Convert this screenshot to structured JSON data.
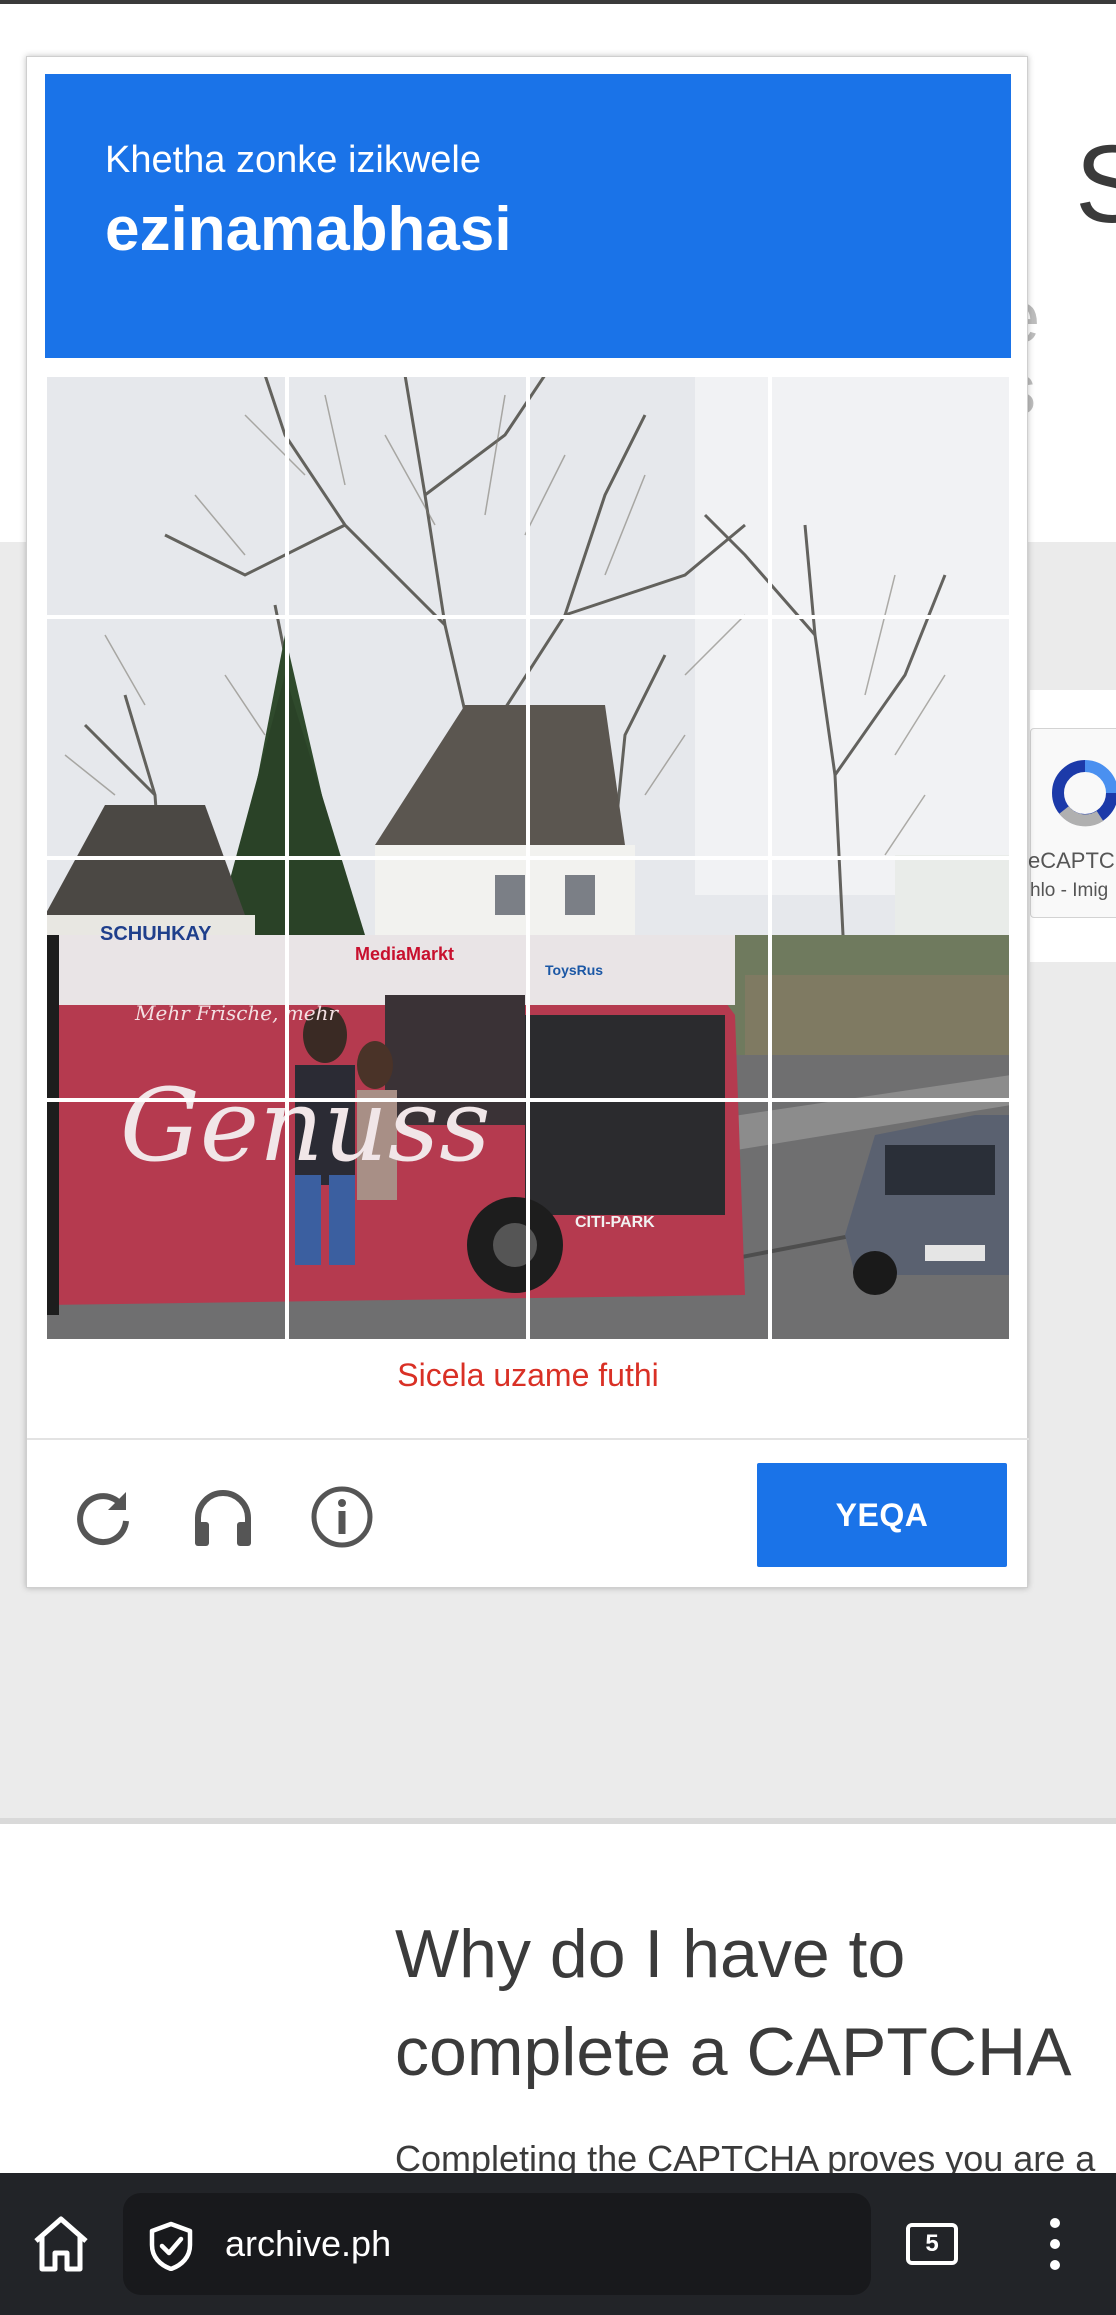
{
  "captcha": {
    "instruction": "Khetha zonke izikwele",
    "target": "ezinamabhasi",
    "error_message": "Sicela uzame futhi",
    "verify_label": "YEQA",
    "image": {
      "ad_brand_1": "SCHUHKAY",
      "ad_brand_2": "MediaMarkt",
      "ad_brand_3": "ToysRus",
      "ad_tagline": "Mehr Frische, mehr",
      "ad_word": "Genuss",
      "bus_label": "CITI-PARK"
    },
    "icons": [
      "reload-icon",
      "headphones-icon",
      "info-icon"
    ],
    "accent_color": "#1a73e8",
    "error_color": "#d93025"
  },
  "background_page": {
    "title_fragment": "S",
    "subtitle_fragment": "e s",
    "widget_label_1": "eCAPTC",
    "widget_label_2": "hlo - Imig",
    "heading_line_1": "Why do I have to",
    "heading_line_2": "complete a CAPTCHA",
    "body_text": "Completing the CAPTCHA proves you are a"
  },
  "browser": {
    "url": "archive.ph",
    "tab_count": "5"
  }
}
